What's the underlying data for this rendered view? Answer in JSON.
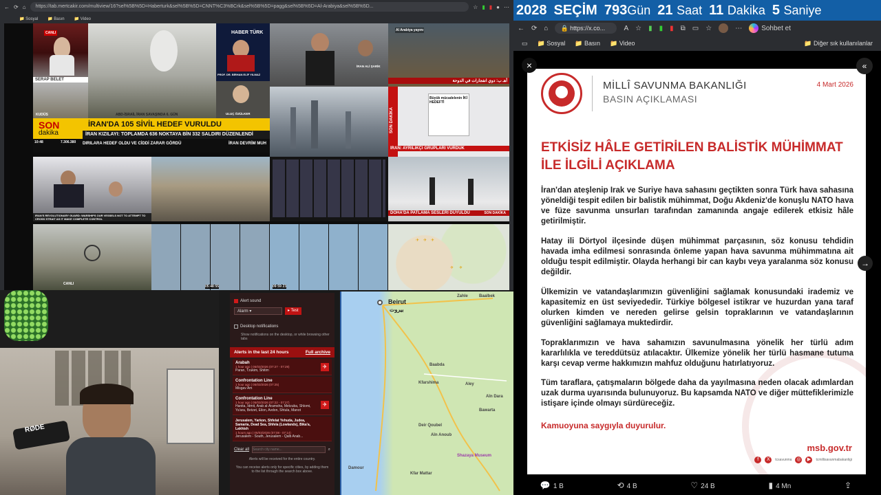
{
  "left_browser": {
    "url": "https://tab.mertcakir.com/multiview/16?sel%5B%5D=Haberturk&sel%5B%5D=CNNT%C3%BCrk&sel%5B%5D=pagg&sel%5B%5D=Al-Arabiya&sel%5B%5D...",
    "bookmarks": [
      "Sosyal",
      "Basın",
      "Video"
    ]
  },
  "tiles": {
    "t1_caption": "SERAP BELET",
    "t1_loc": "KUDÜS",
    "t2_logo": "HABER TÜRK",
    "t2_name": "PROF. DR. BİRHAN ELİF YILMAZ",
    "t2_name2": "ULUÇ ÖZÜLKER",
    "t2_bottom": "ABD-İSRAİL İRAN SAVAŞINDA 6. GÜN",
    "son_dakika_headline": "İRAN'DA 105 SİVİL HEDEF VURULDU",
    "son_dakika_sub": "İRAN KIZILAYI: TOPLAMDA 636 NOKTAYA BİN 332 SALDIRI DÜZENLENDİ",
    "son_dakika_ticker": "DIRILARA HEDEF OLDU VE CİDDİ ZARAR GÖRDÜ",
    "son_dakika_ticker2": "İRAN DEVRİM MUH",
    "son_label": "SON",
    "dakika_label": "dakika",
    "time": "10:48",
    "index": "7.306.380",
    "t3_cap": "İRAN ALİ ŞARİK",
    "t4_cap": "Al Arabiya yayını",
    "t4_arabic": "أهـ ب: دوي انفجارات في الدوحة",
    "t5_headline": "İRAN: AYRILIKÇI GRUPLARI VURDUK",
    "t5_screen": "Büyük mücadelenin İKİ HEDEFTİ",
    "t6_caption": "DOHA'DA PATLAMA SESLERİ DUYULDU",
    "t6_logo": "SON DAKİKA",
    "t7_caption": "IRAN'S REVOLUTIONARY GUARD: WARSHIPS OUR VESSELS NOT TO ATTEMPT TO CROSS STRAIT AS IT MAKE COMPLETE CONTROL",
    "t8_label": "CANLI",
    "cam_time_1": "05:48:55",
    "cam_time_2": "09:59:23"
  },
  "alerts": {
    "alert_sound_label": "Alert sound",
    "alert_sound_select": "Alarm",
    "test_button": "Test",
    "desktop_notifications": "Desktop notifications",
    "desktop_sub": "Show notifications on the desktop, or while browsing other tabs",
    "last24": "Alerts in the last 24 hours",
    "full_archive": "Full archive",
    "items": [
      {
        "name": "Arabah",
        "meta": "1 hour ago | 05/03/2026 (07:27 - 07:29)",
        "loc": "Paran, Tzukim, Shitim"
      },
      {
        "name": "Confrontation Line",
        "meta": "1 hour ago | 05/03/2026 (07:25)",
        "loc": "Misgav Am"
      },
      {
        "name": "Confrontation Line",
        "meta": "1 hour ago | 05/03/2026 (07:22 - 07:27)",
        "loc": "Hanita, Idmit, Arab al-Aramsha, Metzuba, Shlomi, Ya'ara, Betzet, Eilon, Avdon, Shtula, Manot"
      },
      {
        "name": "Jerusalem, Yarkon, Shfelat Yehuda, Judea, Samaria, Dead Sea, Shfela (Lowlands), Bika'a, Lakhish",
        "meta": "1 hours ago | 05/03/2026 (07:08 - 07:14)",
        "loc": "Jerusalem - South, Jerusalem - Qalb Anab..."
      }
    ],
    "clear_all": "Clear all",
    "search_placeholder": "Search city name...",
    "footer1": "Alerts will be received for the entire country.",
    "footer2": "You can receive alerts only for specific cities, by adding them to the list through the search box above."
  },
  "map": {
    "labels": [
      "Beirut",
      "بيروت",
      "Zahle",
      "Baalbek",
      "Baabda",
      "Kfarshima",
      "Deir Qoubel",
      "Aley",
      "Aïn Dara",
      "Damour",
      "Kfar Mattar",
      "Shazaya Museum",
      "Aïn Anoub",
      "Bawarta"
    ]
  },
  "countdown": {
    "year": "2028",
    "word": "SEÇİM",
    "days": "793",
    "days_unit": "Gün",
    "hours": "21",
    "hours_unit": "Saat",
    "minutes": "11",
    "minutes_unit": "Dakika",
    "seconds": "5",
    "seconds_unit": "Saniye"
  },
  "right_browser": {
    "url": "https://x.co...",
    "profile_label": "Sohbet et",
    "bookmarks": [
      "Sosyal",
      "Basın",
      "Video"
    ],
    "other_bookmarks": "Diğer sık kullanılanlar"
  },
  "doc": {
    "ministry": "MİLLÎ SAVUNMA BAKANLIĞI",
    "subtitle": "BASIN AÇIKLAMASI",
    "date": "4 Mart 2026",
    "title": "ETKİSİZ HÂLE GETİRİLEN BALİSTİK MÜHİMMAT İLE İLGİLİ AÇIKLAMA",
    "p1": "İran'dan ateşlenip Irak ve Suriye hava sahasını geçtikten sonra Türk hava sahasına yöneldiği tespit edilen bir balistik mühimmat, Doğu Akdeniz'de konuşlu NATO hava ve füze savunma unsurları tarafından zamanında angaje edilerek etkisiz hâle getirilmiştir.",
    "p2": "Hatay ili Dörtyol ilçesinde düşen mühimmat parçasının, söz konusu tehdidin havada imha edilmesi sonrasında önleme yapan hava savunma mühimmatına ait olduğu tespit edilmiştir. Olayda herhangi bir can kaybı veya yaralanma söz konusu değildir.",
    "p3": "Ülkemizin ve vatandaşlarımızın güvenliğini sağlamak konusundaki irademiz ve kapasitemiz en üst seviyededir. Türkiye bölgesel istikrar ve huzurdan yana taraf olurken kimden ve nereden gelirse gelsin topraklarının ve vatandaşlarının güvenliğini sağlamaya muktedirdir.",
    "p4": "Topraklarımızın ve hava sahamızın savunulmasına yönelik her türlü adım kararlılıkla ve tereddütsüz atılacaktır. Ülkemize yönelik her türlü hasmane tutuma karşı cevap verme hakkımızın mahfuz olduğunu hatırlatıyoruz.",
    "p5": "Tüm taraflara, çatışmaların bölgede daha da yayılmasına neden olacak adımlardan uzak durma uyarısında bulunuyoruz. Bu kapsamda NATO ve diğer müttefiklerimizle istişare içinde olmayı sürdüreceğiz.",
    "closing": "Kamuoyuna saygıyla duyurulur.",
    "website": "msb.gov.tr",
    "social_handle": "tcsavunma",
    "social_handle2": "tcmillisavunmabakanligi"
  },
  "actions": {
    "replies": "1 B",
    "reposts": "4 B",
    "likes": "24 B",
    "views": "4 Mn"
  },
  "colors": {
    "countdown_bg": "#135fa6",
    "doc_red": "#c72a2a",
    "alert_red": "#9b1010",
    "son_dakika_yellow": "#f3c400"
  }
}
